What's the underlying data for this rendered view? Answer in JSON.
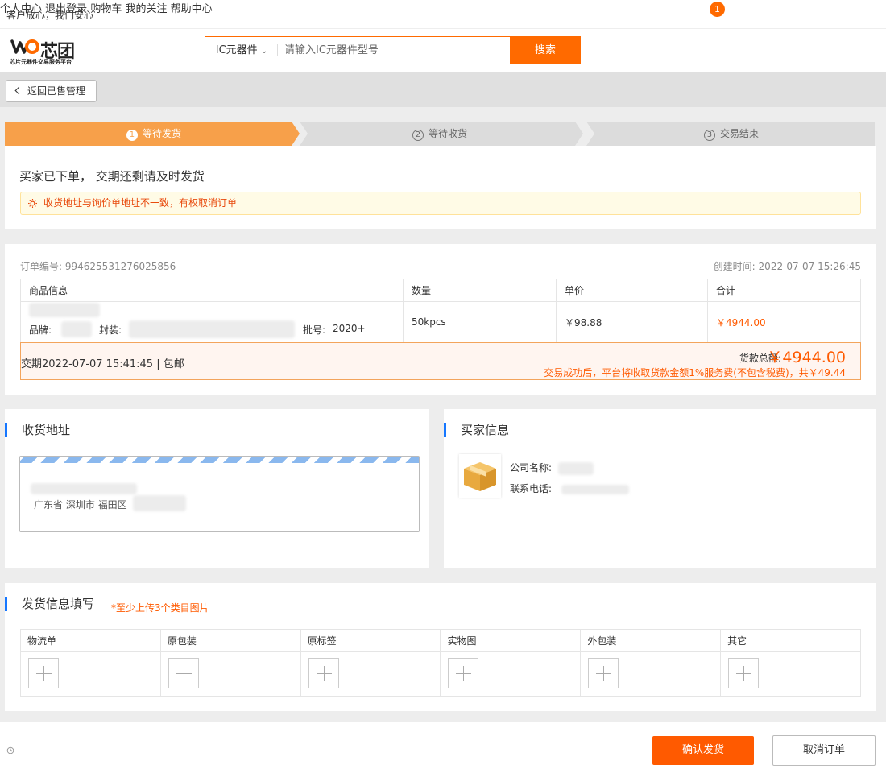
{
  "topbar": {
    "slogan": "客户放心，我们安心",
    "links": [
      "个人中心",
      "退出登录",
      "购物车",
      "我的关注",
      "帮助中心"
    ],
    "cart_badge": "1"
  },
  "logo": {
    "name": "芯团",
    "tagline": "芯片元器件交易服务平台"
  },
  "search": {
    "category": "IC元器件",
    "placeholder": "请输入IC元器件型号",
    "button": "搜索"
  },
  "back_button": "返回已售管理",
  "steps": [
    {
      "num": "1",
      "label": "等待发货"
    },
    {
      "num": "2",
      "label": "等待收货"
    },
    {
      "num": "3",
      "label": "交易结束"
    }
  ],
  "status": {
    "title": "买家已下单， 交期还剩请及时发货",
    "warning": "收货地址与询价单地址不一致，有权取消订单"
  },
  "order": {
    "number_label": "订单编号:",
    "number": "994625531276025856",
    "created_label": "创建时间:",
    "created": "2022-07-07 15:26:45",
    "headers": [
      "商品信息",
      "数量",
      "单价",
      "合计"
    ],
    "brand_label": "品牌:",
    "package_label": "封装:",
    "batch_label": "批号:",
    "batch": "2020+",
    "quantity": "50kpcs",
    "unit_price": "￥98.88",
    "subtotal": "￥4944.00",
    "delivery": "交期2022-07-07 15:41:45 | 包邮",
    "total_label": "货款总额:",
    "total": "￥4944.00",
    "fee_note": "交易成功后，平台将收取货款金额1%服务费(不包含税费)，共￥49.44"
  },
  "address": {
    "title": "收货地址",
    "line2": "广东省 深圳市 福田区"
  },
  "buyer": {
    "title": "买家信息",
    "company_label": "公司名称:",
    "phone_label": "联系电话:"
  },
  "shipping": {
    "title": "发货信息填写",
    "hint": "*至少上传3个类目图片",
    "columns": [
      "物流单",
      "原包装",
      "原标签",
      "实物图",
      "外包装",
      "其它"
    ]
  },
  "footer": {
    "confirm": "确认发货",
    "cancel": "取消订单"
  },
  "colors": {
    "accent": "#ff6a00",
    "step_active": "#f7a04a",
    "section_bar": "#1677ff"
  }
}
